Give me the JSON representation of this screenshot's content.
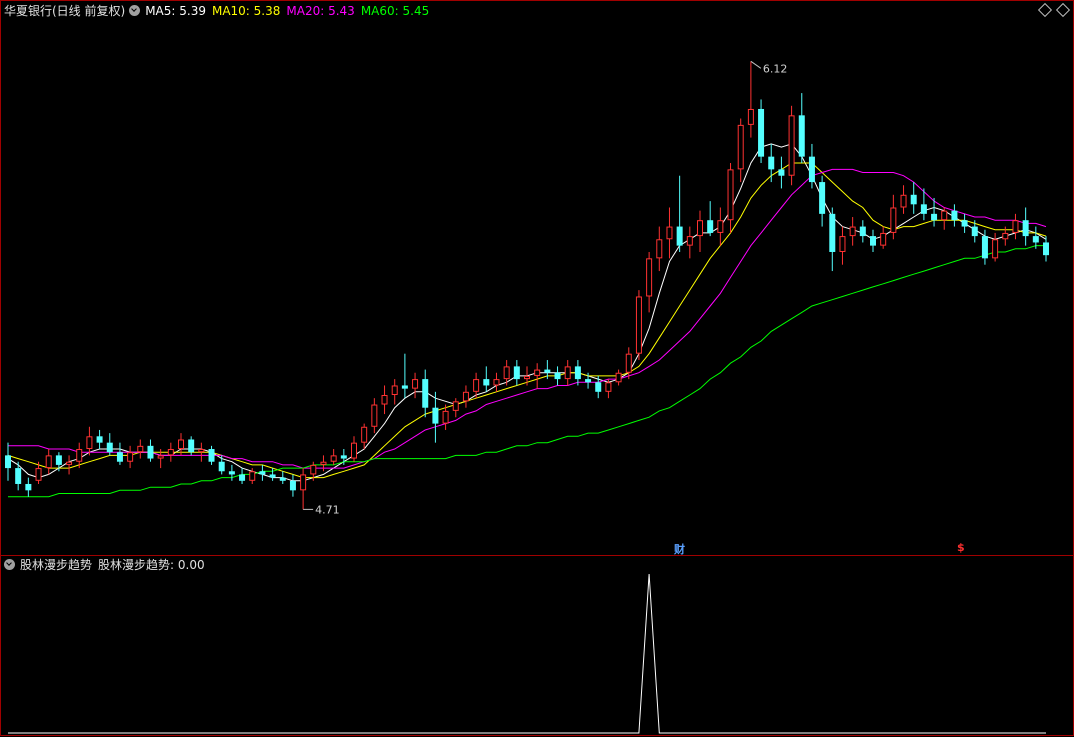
{
  "main_header": {
    "title": "华夏银行(日线 前复权)",
    "ma5": "MA5: 5.39",
    "ma10": "MA10: 5.38",
    "ma20": "MA20: 5.43",
    "ma60": "MA60: 5.45"
  },
  "sub_header": {
    "title": "股林漫步趋势",
    "value": "股林漫步趋势: 0.00"
  },
  "markers": {
    "cai": "财",
    "dollar": "$"
  },
  "colors": {
    "up": "#ff3232",
    "down": "#54ffff",
    "ma5": "#ffffff",
    "ma10": "#ffff00",
    "ma20": "#ff00ff",
    "ma60": "#00ff00",
    "border": "#a00000",
    "indicator": "#ffffff"
  },
  "chart_data": [
    {
      "type": "candlestick",
      "title": "华夏银行(日线 前复权)",
      "ylim": [
        4.62,
        6.25
      ],
      "annotations": [
        {
          "label": "6.12",
          "kind": "high",
          "value": 6.12
        },
        {
          "label": "4.71",
          "kind": "low",
          "value": 4.71
        }
      ],
      "candles": [
        [
          4.88,
          4.92,
          4.8,
          4.84
        ],
        [
          4.84,
          4.86,
          4.77,
          4.79
        ],
        [
          4.79,
          4.81,
          4.75,
          4.77
        ],
        [
          4.8,
          4.86,
          4.79,
          4.84
        ],
        [
          4.84,
          4.9,
          4.82,
          4.88
        ],
        [
          4.88,
          4.89,
          4.83,
          4.85
        ],
        [
          4.85,
          4.88,
          4.82,
          4.86
        ],
        [
          4.86,
          4.92,
          4.84,
          4.9
        ],
        [
          4.9,
          4.97,
          4.88,
          4.94
        ],
        [
          4.94,
          4.96,
          4.9,
          4.92
        ],
        [
          4.92,
          4.95,
          4.88,
          4.89
        ],
        [
          4.89,
          4.92,
          4.85,
          4.86
        ],
        [
          4.86,
          4.91,
          4.84,
          4.89
        ],
        [
          4.89,
          4.93,
          4.87,
          4.91
        ],
        [
          4.91,
          4.93,
          4.86,
          4.87
        ],
        [
          4.87,
          4.9,
          4.84,
          4.88
        ],
        [
          4.88,
          4.92,
          4.86,
          4.9
        ],
        [
          4.9,
          4.95,
          4.88,
          4.93
        ],
        [
          4.93,
          4.94,
          4.88,
          4.89
        ],
        [
          4.89,
          4.92,
          4.86,
          4.9
        ],
        [
          4.9,
          4.91,
          4.85,
          4.86
        ],
        [
          4.86,
          4.88,
          4.82,
          4.83
        ],
        [
          4.83,
          4.85,
          4.8,
          4.82
        ],
        [
          4.82,
          4.84,
          4.79,
          4.8
        ],
        [
          4.8,
          4.84,
          4.79,
          4.83
        ],
        [
          4.83,
          4.85,
          4.8,
          4.82
        ],
        [
          4.82,
          4.84,
          4.8,
          4.81
        ],
        [
          4.81,
          4.83,
          4.79,
          4.8
        ],
        [
          4.8,
          4.82,
          4.75,
          4.77
        ],
        [
          4.77,
          4.84,
          4.71,
          4.82
        ],
        [
          4.82,
          4.86,
          4.8,
          4.85
        ],
        [
          4.85,
          4.88,
          4.83,
          4.86
        ],
        [
          4.86,
          4.9,
          4.85,
          4.88
        ],
        [
          4.88,
          4.9,
          4.85,
          4.87
        ],
        [
          4.87,
          4.94,
          4.86,
          4.92
        ],
        [
          4.92,
          4.98,
          4.9,
          4.97
        ],
        [
          4.97,
          5.06,
          4.95,
          5.04
        ],
        [
          5.04,
          5.1,
          5.01,
          5.07
        ],
        [
          5.07,
          5.12,
          5.04,
          5.1
        ],
        [
          5.1,
          5.2,
          5.06,
          5.09
        ],
        [
          5.09,
          5.14,
          5.06,
          5.12
        ],
        [
          5.12,
          5.15,
          5.0,
          5.03
        ],
        [
          5.03,
          5.08,
          4.92,
          4.98
        ],
        [
          4.98,
          5.04,
          4.96,
          5.02
        ],
        [
          5.02,
          5.06,
          5.0,
          5.05
        ],
        [
          5.05,
          5.1,
          5.03,
          5.08
        ],
        [
          5.08,
          5.14,
          5.06,
          5.12
        ],
        [
          5.12,
          5.16,
          5.08,
          5.1
        ],
        [
          5.1,
          5.14,
          5.08,
          5.12
        ],
        [
          5.12,
          5.18,
          5.1,
          5.16
        ],
        [
          5.16,
          5.18,
          5.1,
          5.12
        ],
        [
          5.12,
          5.16,
          5.1,
          5.13
        ],
        [
          5.13,
          5.17,
          5.09,
          5.15
        ],
        [
          5.15,
          5.18,
          5.12,
          5.14
        ],
        [
          5.14,
          5.16,
          5.1,
          5.12
        ],
        [
          5.12,
          5.18,
          5.1,
          5.16
        ],
        [
          5.16,
          5.18,
          5.1,
          5.12
        ],
        [
          5.12,
          5.14,
          5.09,
          5.11
        ],
        [
          5.11,
          5.13,
          5.06,
          5.08
        ],
        [
          5.08,
          5.12,
          5.06,
          5.11
        ],
        [
          5.11,
          5.15,
          5.1,
          5.14
        ],
        [
          5.14,
          5.22,
          5.12,
          5.2
        ],
        [
          5.2,
          5.4,
          5.18,
          5.38
        ],
        [
          5.38,
          5.52,
          5.33,
          5.5
        ],
        [
          5.5,
          5.6,
          5.46,
          5.56
        ],
        [
          5.56,
          5.66,
          5.5,
          5.6
        ],
        [
          5.6,
          5.76,
          5.52,
          5.54
        ],
        [
          5.54,
          5.6,
          5.5,
          5.57
        ],
        [
          5.57,
          5.65,
          5.52,
          5.62
        ],
        [
          5.62,
          5.68,
          5.57,
          5.58
        ],
        [
          5.58,
          5.66,
          5.54,
          5.62
        ],
        [
          5.62,
          5.8,
          5.58,
          5.78
        ],
        [
          5.78,
          5.94,
          5.74,
          5.92
        ],
        [
          5.92,
          6.12,
          5.88,
          5.97
        ],
        [
          5.97,
          6.0,
          5.8,
          5.82
        ],
        [
          5.82,
          5.86,
          5.74,
          5.78
        ],
        [
          5.78,
          5.82,
          5.72,
          5.76
        ],
        [
          5.76,
          5.98,
          5.73,
          5.95
        ],
        [
          5.95,
          6.02,
          5.8,
          5.82
        ],
        [
          5.82,
          5.86,
          5.72,
          5.74
        ],
        [
          5.74,
          5.76,
          5.6,
          5.64
        ],
        [
          5.64,
          5.66,
          5.46,
          5.52
        ],
        [
          5.52,
          5.6,
          5.48,
          5.57
        ],
        [
          5.57,
          5.63,
          5.54,
          5.6
        ],
        [
          5.6,
          5.62,
          5.55,
          5.57
        ],
        [
          5.57,
          5.59,
          5.52,
          5.54
        ],
        [
          5.54,
          5.6,
          5.53,
          5.58
        ],
        [
          5.58,
          5.7,
          5.56,
          5.66
        ],
        [
          5.66,
          5.73,
          5.64,
          5.7
        ],
        [
          5.7,
          5.74,
          5.64,
          5.67
        ],
        [
          5.67,
          5.72,
          5.62,
          5.64
        ],
        [
          5.64,
          5.69,
          5.6,
          5.62
        ],
        [
          5.62,
          5.66,
          5.59,
          5.65
        ],
        [
          5.65,
          5.67,
          5.6,
          5.62
        ],
        [
          5.62,
          5.64,
          5.58,
          5.6
        ],
        [
          5.6,
          5.62,
          5.55,
          5.57
        ],
        [
          5.57,
          5.59,
          5.48,
          5.5
        ],
        [
          5.5,
          5.58,
          5.49,
          5.56
        ],
        [
          5.56,
          5.6,
          5.54,
          5.58
        ],
        [
          5.58,
          5.64,
          5.56,
          5.62
        ],
        [
          5.62,
          5.66,
          5.54,
          5.57
        ],
        [
          5.57,
          5.6,
          5.53,
          5.55
        ],
        [
          5.55,
          5.57,
          5.49,
          5.51
        ]
      ],
      "series": [
        {
          "name": "MA5",
          "values": [
            4.87,
            4.85,
            4.82,
            4.81,
            4.82,
            4.84,
            4.86,
            4.87,
            4.89,
            4.9,
            4.9,
            4.9,
            4.89,
            4.89,
            4.89,
            4.88,
            4.88,
            4.9,
            4.9,
            4.9,
            4.89,
            4.87,
            4.86,
            4.84,
            4.83,
            4.82,
            4.81,
            4.81,
            4.8,
            4.8,
            4.81,
            4.82,
            4.84,
            4.86,
            4.88,
            4.9,
            4.94,
            4.98,
            5.03,
            5.06,
            5.08,
            5.08,
            5.06,
            5.05,
            5.04,
            5.05,
            5.07,
            5.08,
            5.1,
            5.11,
            5.13,
            5.13,
            5.14,
            5.14,
            5.14,
            5.14,
            5.14,
            5.13,
            5.12,
            5.11,
            5.12,
            5.14,
            5.2,
            5.28,
            5.39,
            5.49,
            5.54,
            5.56,
            5.58,
            5.58,
            5.6,
            5.65,
            5.72,
            5.8,
            5.85,
            5.86,
            5.85,
            5.86,
            5.82,
            5.76,
            5.69,
            5.63,
            5.6,
            5.59,
            5.58,
            5.56,
            5.57,
            5.59,
            5.61,
            5.63,
            5.65,
            5.66,
            5.65,
            5.63,
            5.61,
            5.59,
            5.57,
            5.56,
            5.57,
            5.58,
            5.59,
            5.58,
            5.56
          ]
        },
        {
          "name": "MA10",
          "values": [
            4.88,
            4.87,
            4.86,
            4.85,
            4.84,
            4.84,
            4.84,
            4.85,
            4.86,
            4.87,
            4.88,
            4.88,
            4.88,
            4.89,
            4.89,
            4.89,
            4.89,
            4.89,
            4.89,
            4.89,
            4.89,
            4.88,
            4.87,
            4.86,
            4.85,
            4.85,
            4.84,
            4.83,
            4.82,
            4.81,
            4.81,
            4.81,
            4.82,
            4.83,
            4.84,
            4.85,
            4.88,
            4.91,
            4.94,
            4.97,
            4.99,
            5.01,
            5.02,
            5.03,
            5.04,
            5.05,
            5.06,
            5.07,
            5.08,
            5.09,
            5.1,
            5.11,
            5.12,
            5.13,
            5.13,
            5.14,
            5.14,
            5.13,
            5.13,
            5.13,
            5.13,
            5.14,
            5.16,
            5.2,
            5.25,
            5.3,
            5.35,
            5.4,
            5.45,
            5.5,
            5.54,
            5.58,
            5.63,
            5.69,
            5.73,
            5.76,
            5.78,
            5.8,
            5.8,
            5.8,
            5.77,
            5.74,
            5.71,
            5.68,
            5.66,
            5.62,
            5.6,
            5.59,
            5.6,
            5.6,
            5.61,
            5.62,
            5.62,
            5.62,
            5.62,
            5.61,
            5.6,
            5.59,
            5.59,
            5.59,
            5.58,
            5.58,
            5.57
          ]
        },
        {
          "name": "MA20",
          "values": [
            4.91,
            4.91,
            4.91,
            4.91,
            4.9,
            4.9,
            4.9,
            4.89,
            4.89,
            4.89,
            4.89,
            4.89,
            4.89,
            4.89,
            4.89,
            4.88,
            4.88,
            4.88,
            4.88,
            4.88,
            4.88,
            4.88,
            4.87,
            4.87,
            4.86,
            4.86,
            4.86,
            4.85,
            4.85,
            4.84,
            4.84,
            4.84,
            4.84,
            4.84,
            4.85,
            4.86,
            4.87,
            4.89,
            4.9,
            4.92,
            4.94,
            4.96,
            4.97,
            4.98,
            4.99,
            5.01,
            5.02,
            5.04,
            5.05,
            5.06,
            5.07,
            5.08,
            5.09,
            5.09,
            5.1,
            5.1,
            5.11,
            5.11,
            5.11,
            5.12,
            5.12,
            5.13,
            5.14,
            5.16,
            5.18,
            5.21,
            5.24,
            5.27,
            5.31,
            5.35,
            5.39,
            5.44,
            5.49,
            5.54,
            5.58,
            5.62,
            5.66,
            5.7,
            5.73,
            5.76,
            5.77,
            5.78,
            5.78,
            5.78,
            5.77,
            5.77,
            5.77,
            5.77,
            5.76,
            5.74,
            5.71,
            5.68,
            5.66,
            5.65,
            5.64,
            5.63,
            5.63,
            5.62,
            5.62,
            5.62,
            5.61,
            5.61,
            5.6
          ]
        },
        {
          "name": "MA60",
          "values": [
            4.75,
            4.75,
            4.75,
            4.75,
            4.75,
            4.76,
            4.76,
            4.76,
            4.76,
            4.76,
            4.76,
            4.77,
            4.77,
            4.77,
            4.78,
            4.78,
            4.78,
            4.79,
            4.79,
            4.8,
            4.8,
            4.81,
            4.81,
            4.82,
            4.82,
            4.83,
            4.83,
            4.84,
            4.84,
            4.84,
            4.85,
            4.85,
            4.85,
            4.86,
            4.86,
            4.86,
            4.87,
            4.87,
            4.87,
            4.87,
            4.87,
            4.87,
            4.87,
            4.87,
            4.88,
            4.88,
            4.88,
            4.89,
            4.89,
            4.9,
            4.91,
            4.91,
            4.92,
            4.92,
            4.93,
            4.94,
            4.94,
            4.95,
            4.95,
            4.96,
            4.97,
            4.98,
            4.99,
            5.0,
            5.02,
            5.03,
            5.05,
            5.07,
            5.09,
            5.12,
            5.14,
            5.17,
            5.19,
            5.22,
            5.24,
            5.27,
            5.29,
            5.31,
            5.33,
            5.35,
            5.36,
            5.37,
            5.38,
            5.39,
            5.4,
            5.41,
            5.42,
            5.43,
            5.44,
            5.45,
            5.46,
            5.47,
            5.48,
            5.49,
            5.5,
            5.5,
            5.51,
            5.52,
            5.52,
            5.53,
            5.53,
            5.54,
            5.54
          ]
        }
      ]
    },
    {
      "type": "line",
      "title": "股林漫步趋势",
      "ylim": [
        0,
        1
      ],
      "series": [
        {
          "name": "股林漫步趋势",
          "values": [
            0,
            0,
            0,
            0,
            0,
            0,
            0,
            0,
            0,
            0,
            0,
            0,
            0,
            0,
            0,
            0,
            0,
            0,
            0,
            0,
            0,
            0,
            0,
            0,
            0,
            0,
            0,
            0,
            0,
            0,
            0,
            0,
            0,
            0,
            0,
            0,
            0,
            0,
            0,
            0,
            0,
            0,
            0,
            0,
            0,
            0,
            0,
            0,
            0,
            0,
            0,
            0,
            0,
            0,
            0,
            0,
            0,
            0,
            0,
            0,
            0,
            0,
            0,
            1,
            0,
            0,
            0,
            0,
            0,
            0,
            0,
            0,
            0,
            0,
            0,
            0,
            0,
            0,
            0,
            0,
            0,
            0,
            0,
            0,
            0,
            0,
            0,
            0,
            0,
            0,
            0,
            0,
            0,
            0,
            0,
            0,
            0,
            0,
            0,
            0,
            0,
            0,
            0
          ]
        }
      ]
    }
  ]
}
